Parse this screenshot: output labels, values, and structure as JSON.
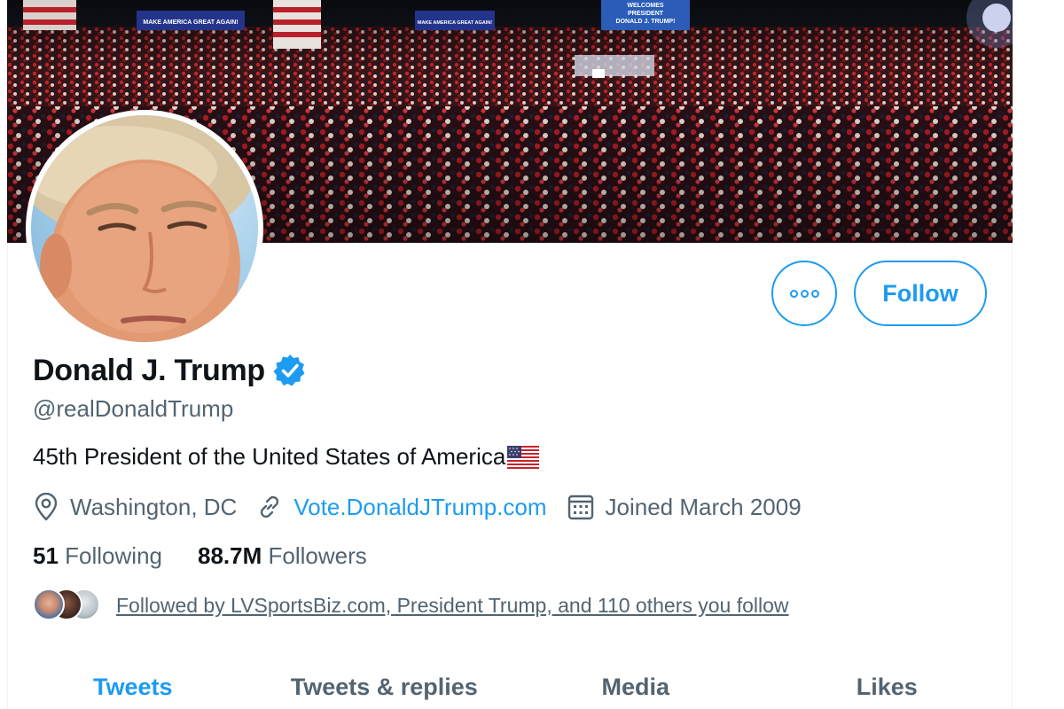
{
  "banner": {
    "signs": [
      "MAKE AMERICA GREAT AGAIN!",
      "MAKE AMERICA GREAT AGAIN!",
      "WELCOMES",
      "PRESIDENT",
      "DONALD J. TRUMP!"
    ]
  },
  "profile": {
    "display_name": "Donald J. Trump",
    "handle": "@realDonaldTrump",
    "bio": "45th President of the United States of America",
    "location": "Washington, DC",
    "website": "Vote.DonaldJTrump.com",
    "joined": "Joined March 2009",
    "verified": true
  },
  "actions": {
    "follow_label": "Follow",
    "more_icon": "more-horizontal-icon"
  },
  "stats": {
    "following_count": "51",
    "following_label": "Following",
    "followers_count": "88.7M",
    "followers_label": "Followers"
  },
  "followed_by": {
    "text": "Followed by LVSportsBiz.com, President Trump, and 110 others you follow"
  },
  "tabs": [
    {
      "label": "Tweets",
      "active": true
    },
    {
      "label": "Tweets & replies",
      "active": false
    },
    {
      "label": "Media",
      "active": false
    },
    {
      "label": "Likes",
      "active": false
    }
  ],
  "colors": {
    "accent": "#1d9bf0",
    "text_primary": "#0f1419",
    "text_secondary": "#536471"
  }
}
